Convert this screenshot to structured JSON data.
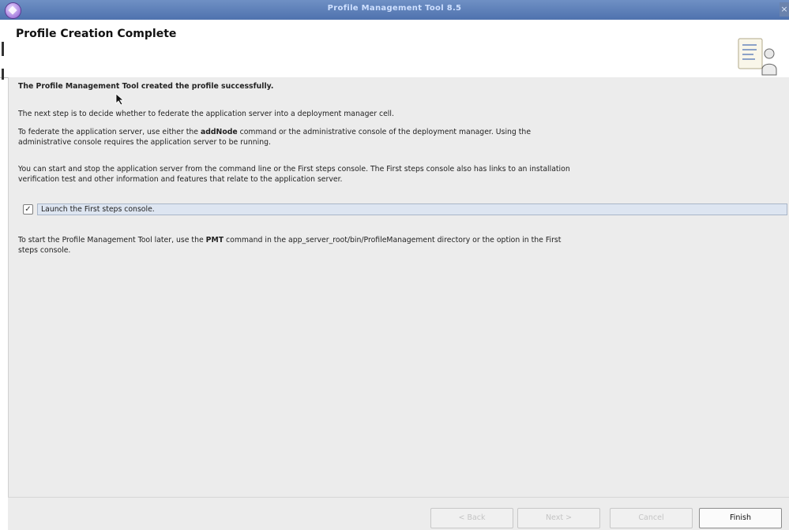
{
  "window": {
    "title": "Profile Management Tool 8.5"
  },
  "header": {
    "title": "Profile Creation Complete"
  },
  "content": {
    "success_message": "The Profile Management Tool created the profile successfully.",
    "next_step": "The next step is to decide whether to federate the application server into a deployment manager cell.",
    "federate_before": "To federate the application server, use either the ",
    "federate_command": "addNode",
    "federate_after": " command or the administrative console of the deployment manager. Using the",
    "federate_line2": "administrative console requires the application server to be running.",
    "start_stop_line1": "You can start and stop the application server from the command line or the First steps console. The First steps console also has links to an installation",
    "start_stop_line2": "verification test and other information and features that relate to the application server.",
    "launch_checkbox_label": "Launch the First steps console.",
    "launch_checkbox_checked": true,
    "pmt_before": "To start the Profile Management Tool later, use the ",
    "pmt_command": "PMT",
    "pmt_after": " command in the app_server_root/bin/ProfileManagement directory or the option in the First",
    "pmt_line2": "steps console."
  },
  "buttons": {
    "back": "< Back",
    "next": "Next >",
    "cancel": "Cancel",
    "finish": "Finish"
  },
  "icons": {
    "app": "was-app-icon",
    "header": "profile-document-person-icon",
    "close": "close-icon",
    "cursor": "mouse-pointer-icon"
  },
  "colors": {
    "titlebar": "#5a7db7",
    "content_bg": "#ececec",
    "checkbox_highlight": "#dde5f1"
  }
}
